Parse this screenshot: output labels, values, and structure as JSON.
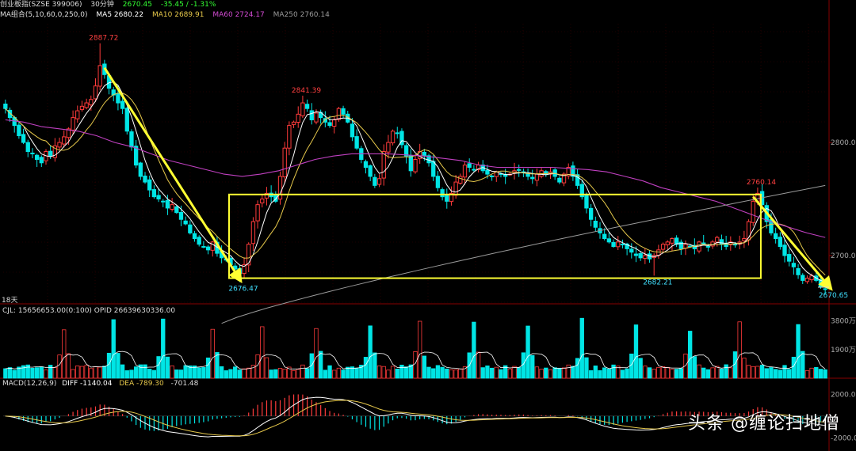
{
  "header": {
    "title": "创业板指(SZSE 399006)",
    "period": "30分钟",
    "price": "2670.45",
    "change": "-35.45 / -1.31%"
  },
  "ma_legend": {
    "label": "MA组合(5,10,60,0,250,0)",
    "items": [
      {
        "text": "MA5 2680.22",
        "color": "#ffffff"
      },
      {
        "text": "MA10 2689.91",
        "color": "#e6c84b"
      },
      {
        "text": "MA60 2724.17",
        "color": "#d24bd2"
      },
      {
        "text": "MA250 2760.14",
        "color": "#9a9a9a"
      }
    ]
  },
  "vol_legend": {
    "text": "CJL: 15656653.00(0:100)  OPID 26639630336.00"
  },
  "macd_legend": {
    "label": "MACD(12,26,9)",
    "diff": "DIFF -1140.04",
    "dea": "DEA -789.30",
    "macd": "-701.48"
  },
  "left_tag": "18天",
  "watermark": "头条 @缠论扫地僧",
  "colors": {
    "up": "#ff3b3b",
    "down": "#00e5e5",
    "ma5": "#ffffff",
    "ma10": "#e6c84b",
    "ma60": "#c040c0",
    "ma250": "#9a9a9a",
    "box": "#ffff33",
    "arrow": "#ffff33",
    "grid": "#3a0000",
    "axis_label": "#aaaaaa",
    "high_label": "#ff4040",
    "low_label": "#40e0ff"
  },
  "chart_data": [
    {
      "type": "candlestick",
      "name": "price",
      "y_ticks": [
        2800.0,
        2700.0
      ],
      "ylim": [
        2658,
        2905
      ],
      "annotations": [
        {
          "label": "2887.72",
          "value": 2887.72,
          "index": 21,
          "kind": "high"
        },
        {
          "label": "2841.39",
          "value": 2841.39,
          "index": 66,
          "kind": "high"
        },
        {
          "label": "2760.14",
          "value": 2760.14,
          "index": 167,
          "kind": "high"
        },
        {
          "label": "2682.21",
          "value": 2682.21,
          "index": 144,
          "kind": "low"
        },
        {
          "label": "2676.47",
          "value": 2676.47,
          "index": 52,
          "kind": "low"
        },
        {
          "label": "2670.65",
          "value": 2670.65,
          "index": 183,
          "kind": "low"
        }
      ],
      "close": [
        2830,
        2822,
        2815,
        2806,
        2800,
        2792,
        2790,
        2785,
        2782,
        2792,
        2788,
        2797,
        2800,
        2805,
        2812,
        2822,
        2828,
        2832,
        2835,
        2838,
        2850,
        2868,
        2860,
        2848,
        2842,
        2835,
        2830,
        2810,
        2796,
        2780,
        2770,
        2765,
        2758,
        2752,
        2750,
        2748,
        2742,
        2745,
        2738,
        2732,
        2728,
        2720,
        2715,
        2710,
        2708,
        2705,
        2712,
        2702,
        2698,
        2696,
        2692,
        2688,
        2684,
        2692,
        2710,
        2730,
        2745,
        2750,
        2755,
        2752,
        2748,
        2770,
        2795,
        2815,
        2818,
        2825,
        2835,
        2830,
        2820,
        2826,
        2822,
        2818,
        2815,
        2820,
        2830,
        2825,
        2818,
        2805,
        2795,
        2785,
        2778,
        2770,
        2762,
        2768,
        2792,
        2800,
        2810,
        2808,
        2798,
        2788,
        2775,
        2785,
        2792,
        2788,
        2782,
        2770,
        2760,
        2752,
        2748,
        2755,
        2765,
        2770,
        2780,
        2778,
        2776,
        2780,
        2775,
        2772,
        2770,
        2774,
        2772,
        2770,
        2772,
        2775,
        2776,
        2774,
        2770,
        2768,
        2772,
        2775,
        2772,
        2774,
        2770,
        2765,
        2772,
        2778,
        2770,
        2762,
        2752,
        2742,
        2732,
        2725,
        2720,
        2715,
        2712,
        2708,
        2712,
        2710,
        2706,
        2703,
        2700,
        2698,
        2700,
        2697,
        2700,
        2705,
        2710,
        2712,
        2715,
        2710,
        2706,
        2710,
        2708,
        2706,
        2712,
        2710,
        2708,
        2712,
        2716,
        2710,
        2708,
        2712,
        2710,
        2712,
        2715,
        2730,
        2748,
        2755,
        2745,
        2730,
        2720,
        2715,
        2708,
        2700,
        2695,
        2690,
        2683,
        2678,
        2680,
        2682,
        2678,
        2672,
        2670
      ],
      "ma250": {
        "start": 2640,
        "end": 2762
      },
      "ma60": [
        2820,
        2818,
        2814,
        2812,
        2810,
        2806,
        2800,
        2796,
        2790,
        2784,
        2780,
        2776,
        2772,
        2770,
        2772,
        2775,
        2780,
        2785,
        2788,
        2790,
        2790,
        2790,
        2789,
        2788,
        2786,
        2784,
        2780,
        2778,
        2778,
        2778,
        2778,
        2777,
        2776,
        2774,
        2770,
        2766,
        2760,
        2756,
        2752,
        2748,
        2742,
        2736,
        2730,
        2725,
        2720,
        2716
      ],
      "x_ticks": []
    },
    {
      "type": "bar",
      "name": "volume",
      "y_ticks_labels": [
        "3800万",
        "1900万"
      ],
      "ylim": [
        0,
        4200
      ],
      "cycle_peaks": [
        13,
        24,
        35,
        46,
        57,
        69,
        81,
        92,
        104,
        116,
        128,
        140,
        152,
        163,
        176,
        188
      ],
      "series": [
        {
          "name": "CJL",
          "note": "per-bar volume, 万"
        }
      ]
    },
    {
      "type": "line",
      "name": "macd",
      "y_ticks": [
        2000.0,
        -2000.0
      ],
      "ylim": [
        -3200,
        2600
      ],
      "series": [
        {
          "name": "DIFF",
          "last": -1140.04
        },
        {
          "name": "DEA",
          "last": -789.3
        },
        {
          "name": "MACD",
          "last": -701.48
        }
      ]
    }
  ]
}
